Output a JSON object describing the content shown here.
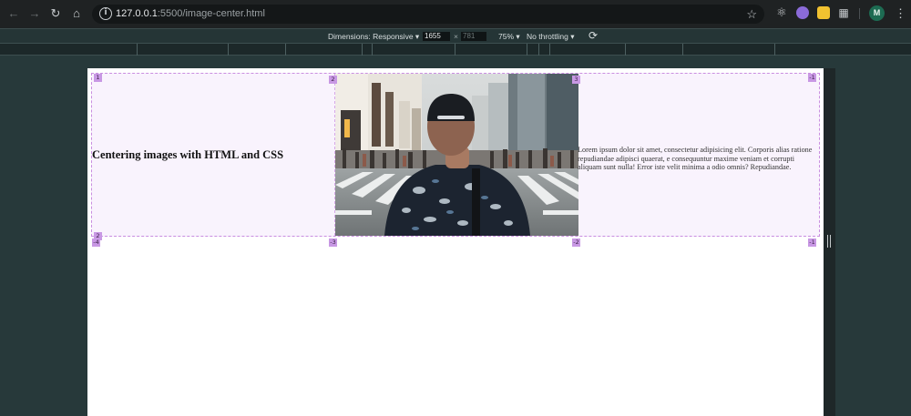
{
  "browser": {
    "url_host": "127.0.0.1",
    "url_rest": ":5500/image-center.html",
    "avatar_letter": "M"
  },
  "device_toolbar": {
    "dimensions_label": "Dimensions: Responsive",
    "width": "1655",
    "x_sep": "×",
    "height": "781",
    "zoom": "75%",
    "throttling": "No throttling"
  },
  "page": {
    "heading": "Centering images with HTML and CSS",
    "paragraph": "Lorem ipsum dolor sit amet, consectetur adipisicing elit. Corporis alias ratione repudiandae adipisci quaerat, e consequuntur maxime veniam et corrupti aliquam sunt nulla! Error iste velit minima a odio omnis? Repudiandae.",
    "photo_alt": "Person in patterned shirt and cap facing a busy city crosswalk"
  },
  "grid_overlay": {
    "top_labels": [
      "1",
      "2",
      "3",
      "-1"
    ],
    "bottom_labels": [
      "-4",
      "-3",
      "-2",
      "-1"
    ],
    "row_label": "2"
  },
  "colors": {
    "grid_line": "#c98ee0",
    "grid_fill": "#f9f3fd",
    "grid_badge": "#c898e4"
  }
}
